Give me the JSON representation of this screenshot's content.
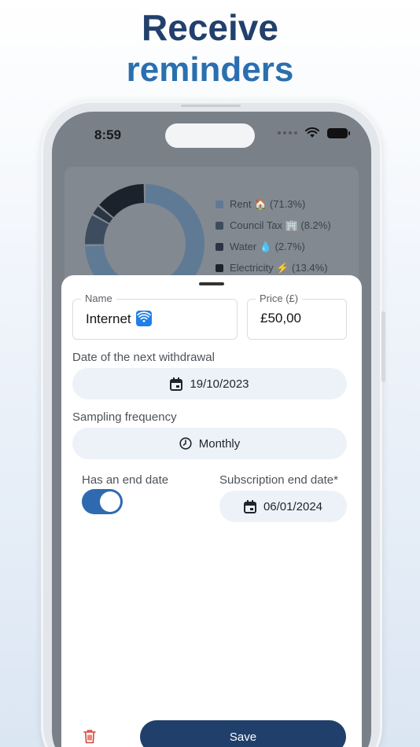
{
  "headline": {
    "line1": "Receive",
    "line2": "reminders"
  },
  "status_bar": {
    "time": "8:59"
  },
  "chart_data": {
    "type": "pie",
    "categories": [
      "Rent 🏠",
      "Council Tax 🏢",
      "Water 💧",
      "Electricity ⚡"
    ],
    "values": [
      71.3,
      8.2,
      2.7,
      13.4
    ],
    "labels": [
      "Rent 🏠 (71.3%)",
      "Council Tax 🏢 (8.2%)",
      "Water 💧 (2.7%)",
      "Electricity ⚡ (13.4%)"
    ],
    "colors": [
      "#5f7a95",
      "#3d4c5f",
      "#2a3442",
      "#1b222c"
    ]
  },
  "form": {
    "name_label": "Name",
    "name_value": "Internet",
    "price_label": "Price (£)",
    "price_value": "£50,00",
    "next_withdrawal_label": "Date of the next withdrawal",
    "next_withdrawal_value": "19/10/2023",
    "frequency_label": "Sampling frequency",
    "frequency_value": "Monthly",
    "end_date_toggle_label": "Has an end date",
    "end_date_toggle_on": true,
    "end_date_label": "Subscription end date*",
    "end_date_value": "06/01/2024",
    "save_label": "Save"
  },
  "colors": {
    "primary": "#213f6b",
    "accent": "#2f6ab0",
    "delete": "#d9433a"
  }
}
